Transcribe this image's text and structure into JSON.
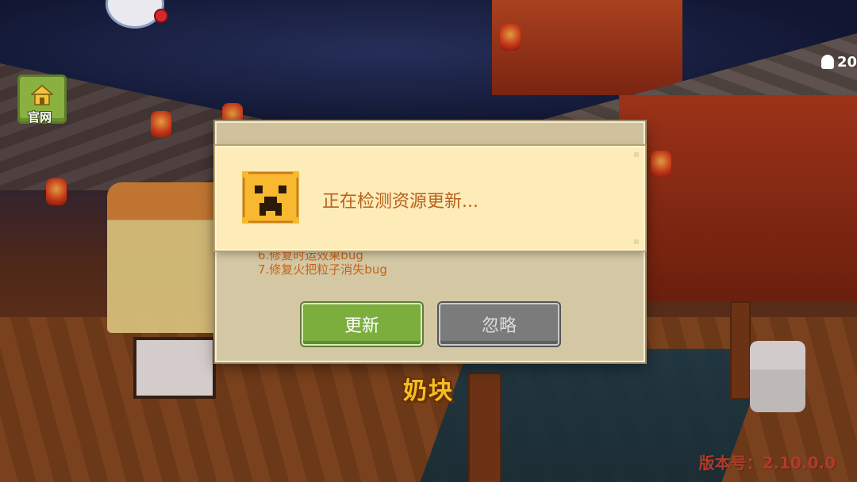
{
  "top_left": {
    "official_site_label": "官网"
  },
  "top_right": {
    "online_count": "20"
  },
  "dialog": {
    "notes": [
      "6.修复时运效果bug",
      "7.修复火把粒子消失bug"
    ],
    "update_button": "更新",
    "ignore_button": "忽略"
  },
  "toast": {
    "message": "正在检测资源更新..."
  },
  "logo_text": "奶块",
  "version_text": "版本号：2.10.0.0",
  "colors": {
    "update_green": "#7cae3e",
    "ignore_gray": "#7b7b7b",
    "toast_bg": "#fdebb8",
    "message_text": "#b8621c",
    "version_red": "#b23a2a"
  },
  "icons": {
    "toast_icon": "creeper-face-icon",
    "site_icon": "house-icon",
    "online_icon": "ghost-icon"
  }
}
